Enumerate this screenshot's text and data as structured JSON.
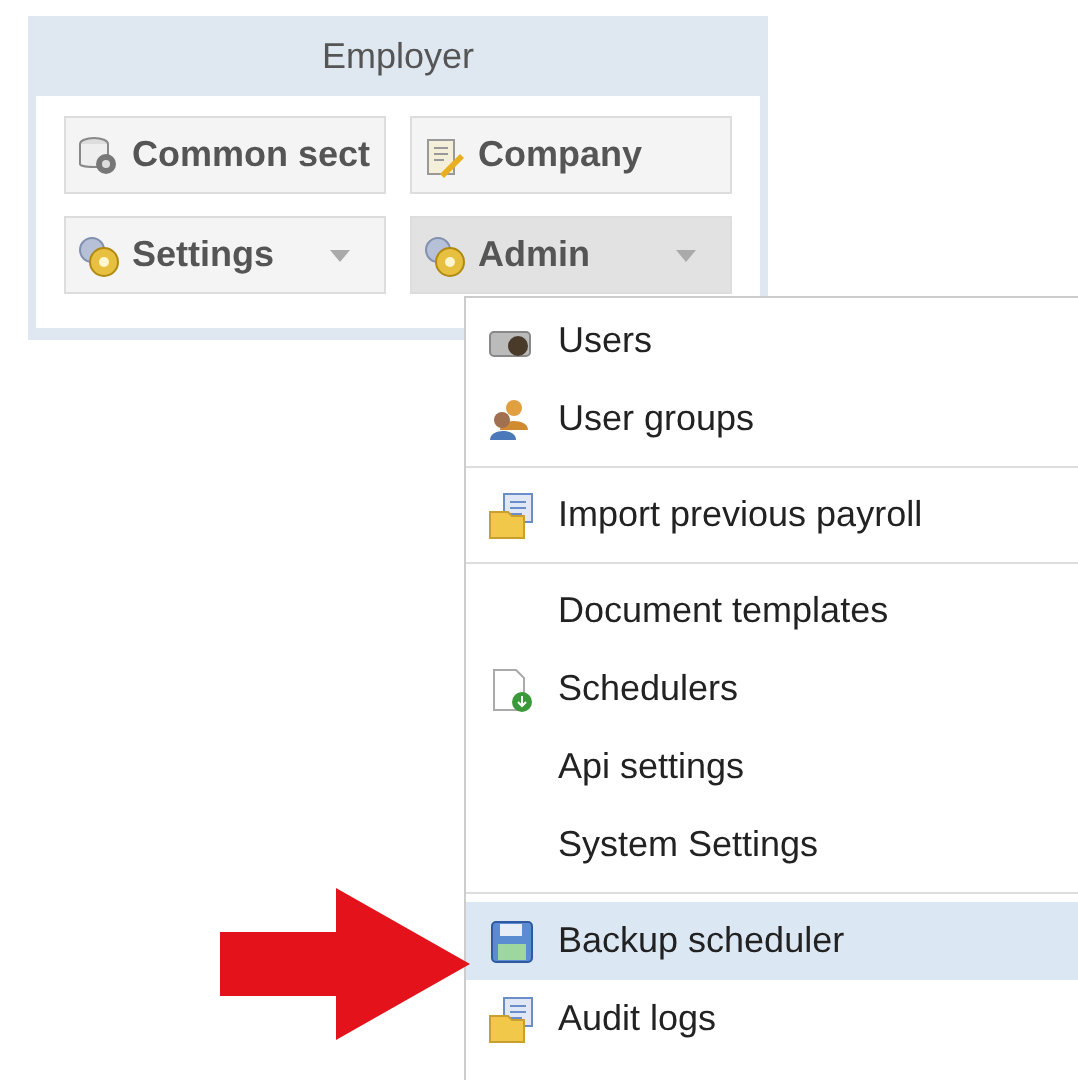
{
  "panel": {
    "title": "Employer",
    "buttons": [
      {
        "label": "Common sect",
        "kind": "database",
        "dropdown": false,
        "selected": false
      },
      {
        "label": "Company",
        "kind": "document",
        "dropdown": false,
        "selected": false
      },
      {
        "label": "Settings",
        "kind": "gear",
        "dropdown": true,
        "selected": false
      },
      {
        "label": "Admin",
        "kind": "gear",
        "dropdown": true,
        "selected": true
      }
    ]
  },
  "menu": {
    "items": [
      {
        "label": "Users",
        "kind": "user",
        "separator_before": false,
        "selected": false
      },
      {
        "label": "User groups",
        "kind": "group",
        "separator_before": false,
        "selected": false
      },
      {
        "label": "Import previous payroll",
        "kind": "folder",
        "separator_before": true,
        "selected": false
      },
      {
        "label": "Document templates",
        "kind": "plain",
        "separator_before": true,
        "selected": false
      },
      {
        "label": "Schedulers",
        "kind": "page",
        "separator_before": false,
        "selected": false
      },
      {
        "label": "Api settings",
        "kind": "plain",
        "separator_before": false,
        "selected": false
      },
      {
        "label": "System Settings",
        "kind": "plain",
        "separator_before": false,
        "selected": false
      },
      {
        "label": "Backup scheduler",
        "kind": "disk",
        "separator_before": true,
        "selected": true
      },
      {
        "label": "Audit logs",
        "kind": "folder",
        "separator_before": false,
        "selected": false
      }
    ]
  }
}
